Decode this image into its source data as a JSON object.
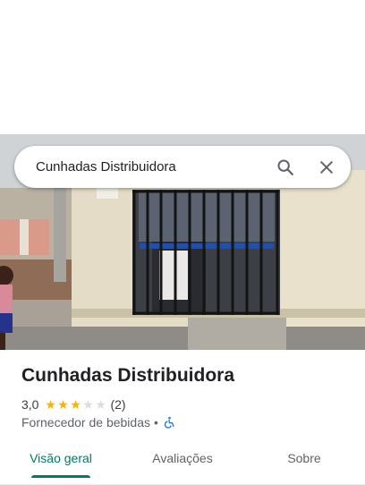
{
  "search": {
    "query": "Cunhadas Distribuidora"
  },
  "icons": {
    "search": "search-icon",
    "close": "close-icon",
    "accessibility": "wheelchair-icon",
    "star": "star-icon"
  },
  "place": {
    "name": "Cunhadas Distribuidora",
    "rating": "3,0",
    "rating_value": 3,
    "rating_max": 5,
    "review_count": "(2)",
    "category": "Fornecedor de bebidas",
    "separator": "•"
  },
  "tabs": [
    {
      "label": "Visão geral",
      "active": true
    },
    {
      "label": "Avaliações",
      "active": false
    },
    {
      "label": "Sobre",
      "active": false
    }
  ],
  "colors": {
    "accent": "#00796b",
    "star_full": "#f4b400",
    "star_empty": "#dadce0",
    "accessibility_icon": "#1a73e8"
  }
}
